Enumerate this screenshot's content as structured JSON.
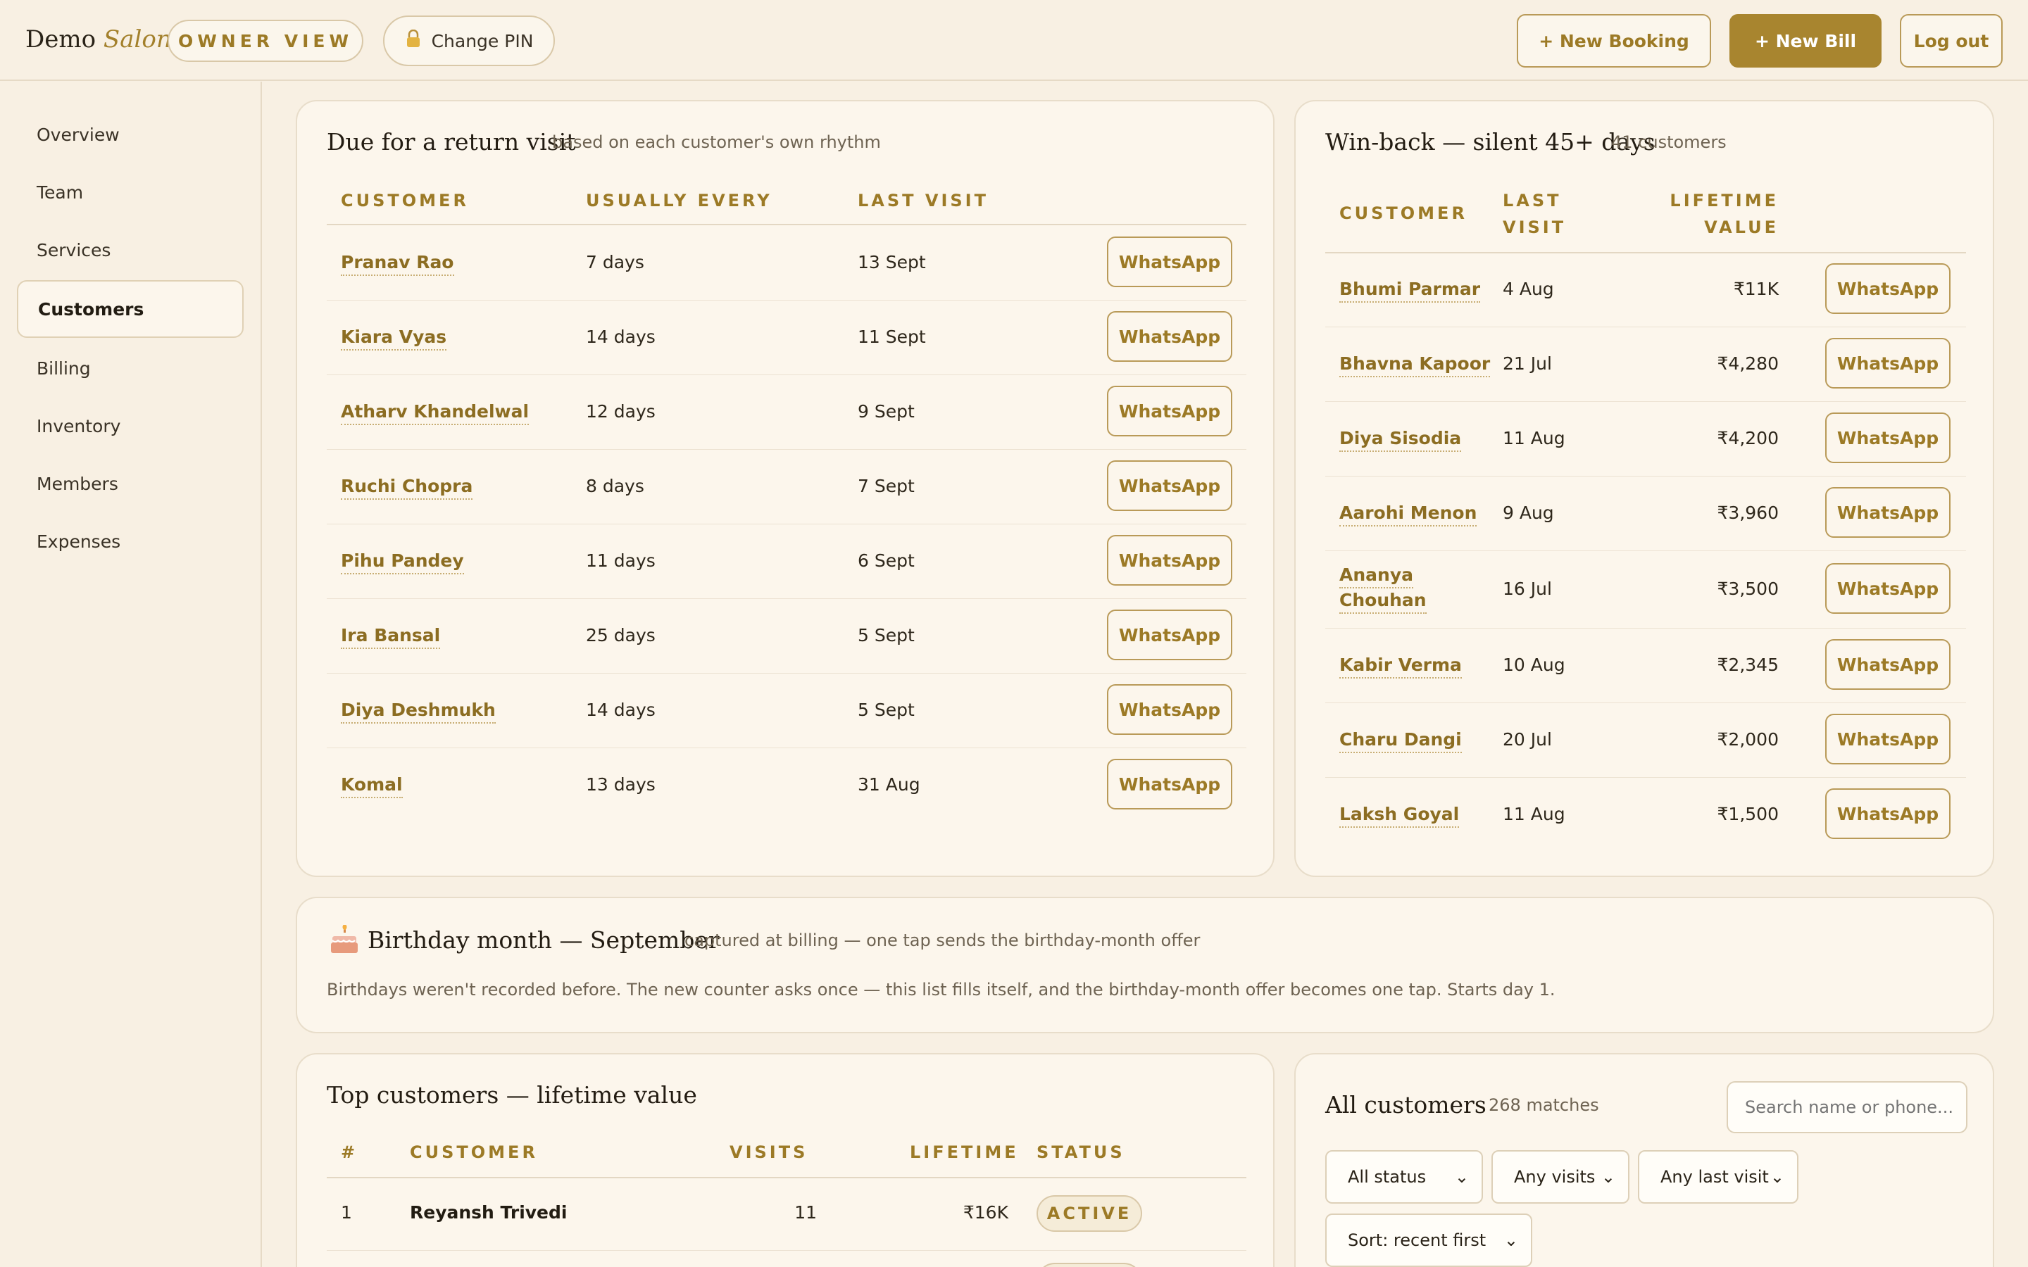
{
  "header": {
    "brand_main": "Demo",
    "brand_accent": "Salon",
    "owner_view": "OWNER VIEW",
    "change_pin": "Change PIN",
    "new_booking": "+ New Booking",
    "new_bill": "+ New Bill",
    "log_out": "Log out"
  },
  "sidebar": {
    "items": [
      {
        "label": "Overview"
      },
      {
        "label": "Team"
      },
      {
        "label": "Services"
      },
      {
        "label": "Customers",
        "active": true
      },
      {
        "label": "Billing"
      },
      {
        "label": "Inventory"
      },
      {
        "label": "Members"
      },
      {
        "label": "Expenses"
      }
    ]
  },
  "due": {
    "title": "Due for a return visit",
    "subtitle": "based on each customer's own rhythm",
    "col_customer": "CUSTOMER",
    "col_every": "USUALLY EVERY",
    "col_last": "LAST VISIT",
    "action": "WhatsApp",
    "rows": [
      {
        "name": "Pranav Rao",
        "every": "7 days",
        "last": "13 Sept"
      },
      {
        "name": "Kiara Vyas",
        "every": "14 days",
        "last": "11 Sept"
      },
      {
        "name": "Atharv Khandelwal",
        "every": "12 days",
        "last": "9 Sept"
      },
      {
        "name": "Ruchi Chopra",
        "every": "8 days",
        "last": "7 Sept"
      },
      {
        "name": "Pihu Pandey",
        "every": "11 days",
        "last": "6 Sept"
      },
      {
        "name": "Ira Bansal",
        "every": "25 days",
        "last": "5 Sept"
      },
      {
        "name": "Diya Deshmukh",
        "every": "14 days",
        "last": "5 Sept"
      },
      {
        "name": "Komal",
        "every": "13 days",
        "last": "31 Aug"
      }
    ]
  },
  "winback": {
    "title": "Win-back — silent 45+ days",
    "subtitle": "41 customers",
    "col_customer": "CUSTOMER",
    "col_last_1": "LAST",
    "col_last_2": "VISIT",
    "col_value_1": "LIFETIME",
    "col_value_2": "VALUE",
    "action": "WhatsApp",
    "rows": [
      {
        "name": "Bhumi Parmar",
        "last": "4 Aug",
        "value": "₹11K"
      },
      {
        "name": "Bhavna Kapoor",
        "last": "21 Jul",
        "value": "₹4,280"
      },
      {
        "name": "Diya Sisodia",
        "last": "11 Aug",
        "value": "₹4,200"
      },
      {
        "name": "Aarohi Menon",
        "last": "9 Aug",
        "value": "₹3,960"
      },
      {
        "name_1": "Ananya",
        "name_2": "Chouhan",
        "last": "16 Jul",
        "value": "₹3,500"
      },
      {
        "name": "Kabir Verma",
        "last": "10 Aug",
        "value": "₹2,345"
      },
      {
        "name": "Charu Dangi",
        "last": "20 Jul",
        "value": "₹2,000"
      },
      {
        "name": "Laksh Goyal",
        "last": "11 Aug",
        "value": "₹1,500"
      }
    ]
  },
  "birthday": {
    "icon": "cake-icon",
    "title": "Birthday month — September",
    "subtitle": "captured at billing — one tap sends the birthday-month offer",
    "note": "Birthdays weren't recorded before. The new counter asks once — this list fills itself, and the birthday-month offer becomes one tap. Starts day 1."
  },
  "top": {
    "title": "Top customers — lifetime value",
    "col_rank": "#",
    "col_customer": "CUSTOMER",
    "col_visits": "VISITS",
    "col_lifetime": "LIFETIME",
    "col_status": "STATUS",
    "rows": [
      {
        "rank": "1",
        "name": "Reyansh Trivedi",
        "visits": "11",
        "lifetime": "₹16K",
        "status": "ACTIVE"
      }
    ]
  },
  "all": {
    "title": "All customers",
    "count": "268 matches",
    "search_placeholder": "Search name or phone...",
    "filter_status": "All status",
    "filter_visits": "Any visits",
    "filter_last": "Any last visit",
    "sort": "Sort: recent first"
  },
  "colors": {
    "accent": "#a8852f",
    "background": "#f8f0e3",
    "card": "#fcf6ec"
  }
}
